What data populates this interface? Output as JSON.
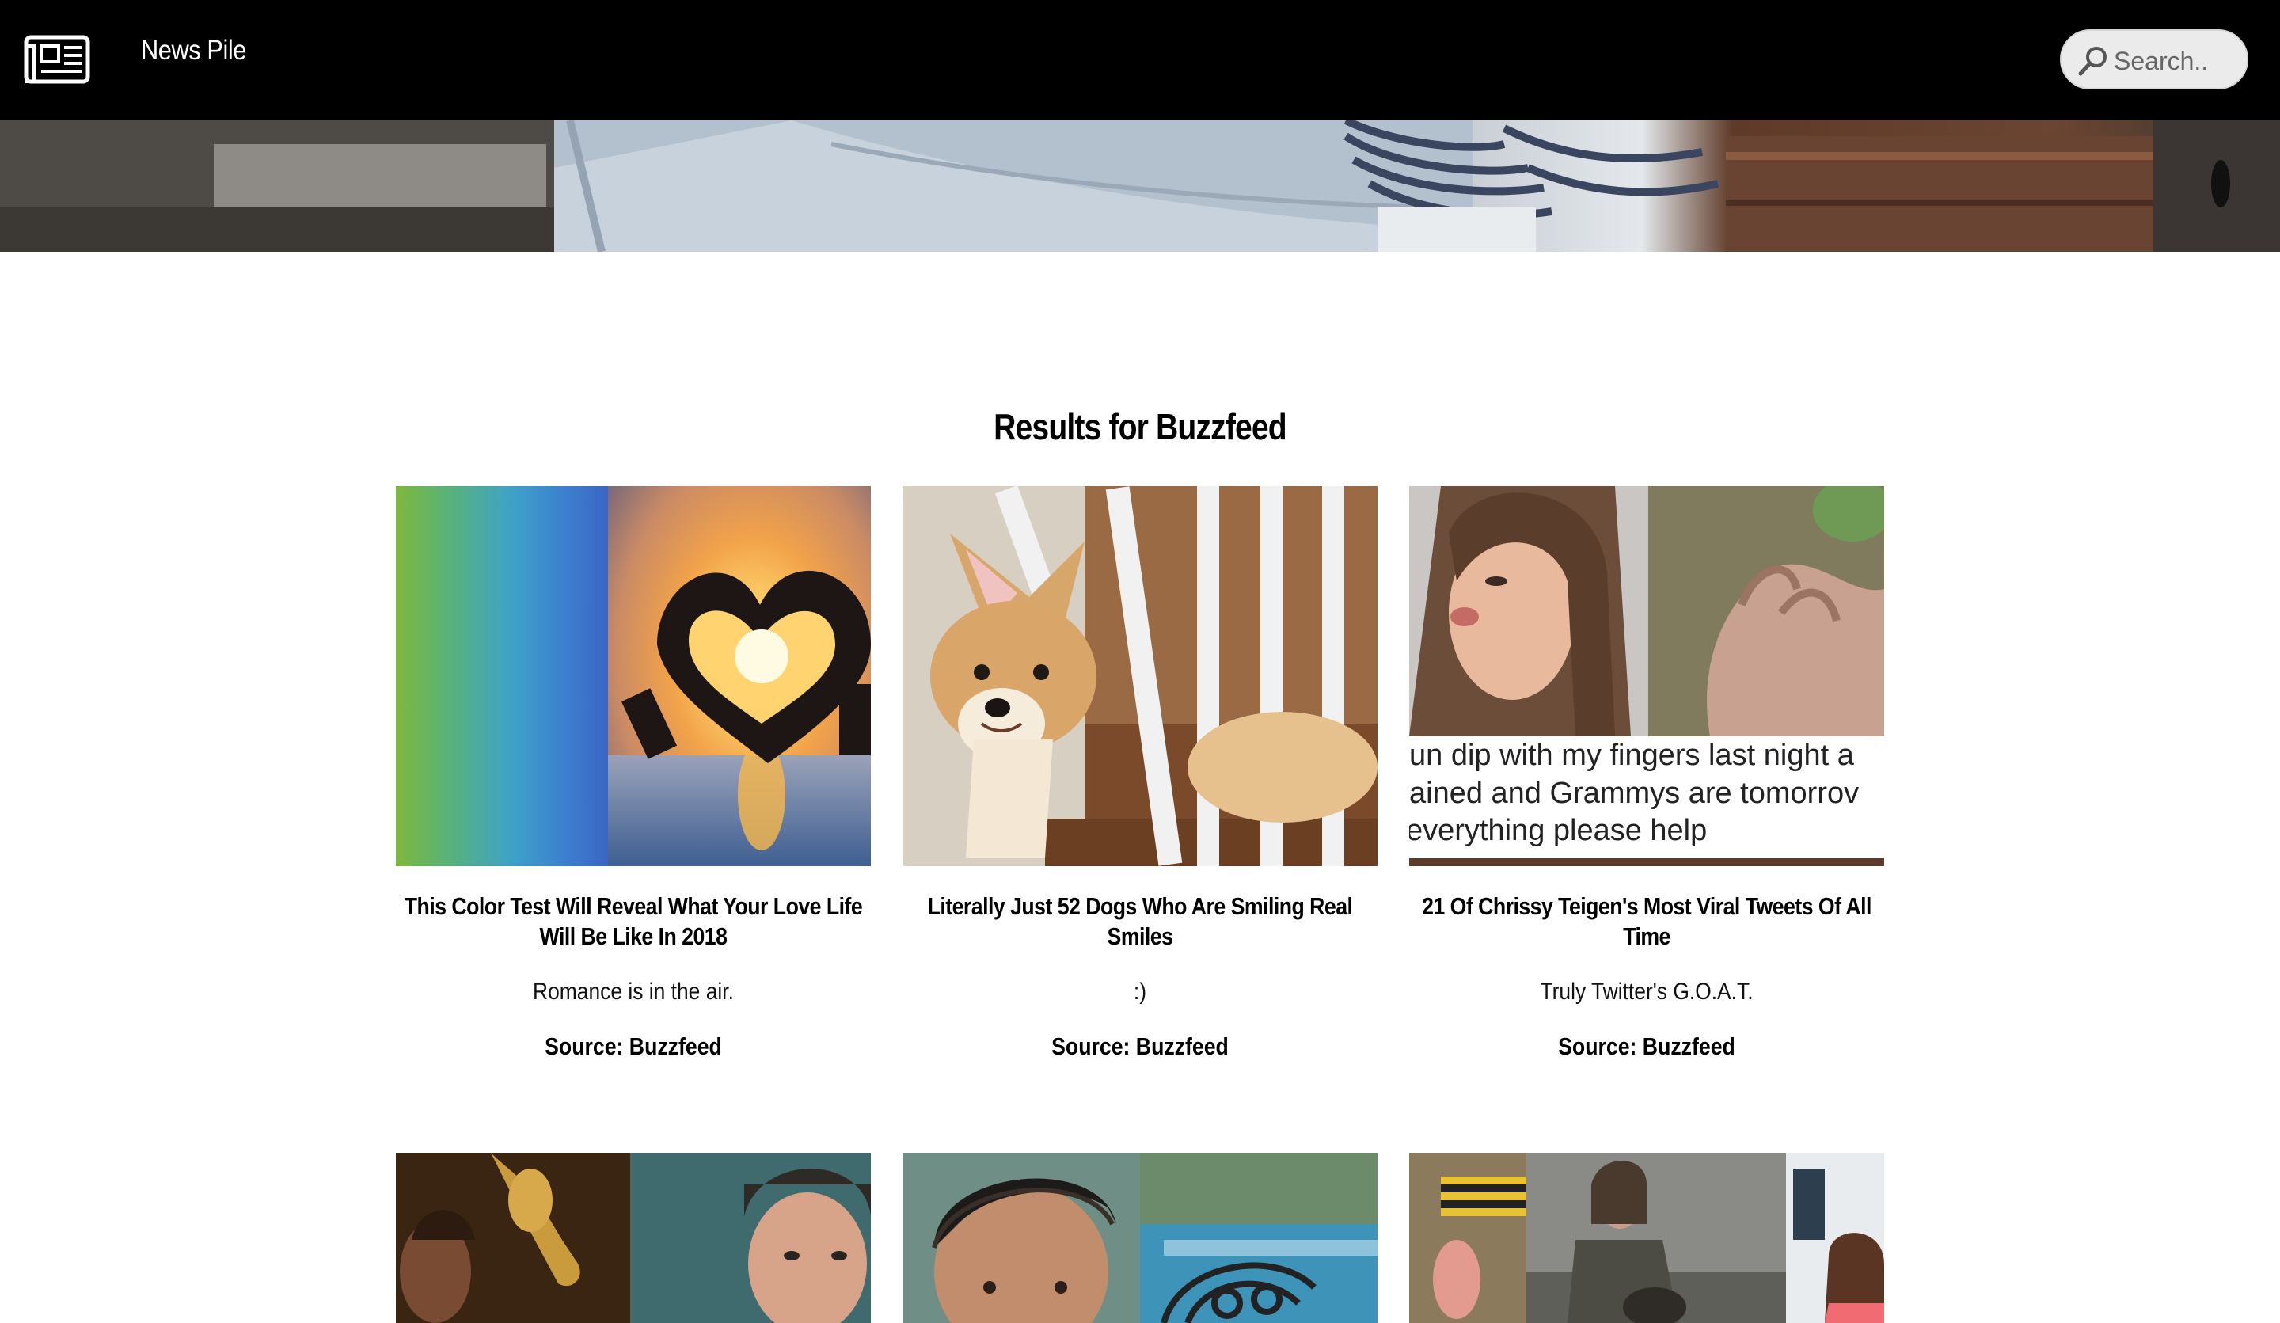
{
  "app": {
    "brand": "News Pile",
    "logo_icon": "newspaper-icon"
  },
  "search": {
    "placeholder": "Search.."
  },
  "results": {
    "heading": "Results for Buzzfeed"
  },
  "articles": [
    {
      "title": "This Color Test Will Reveal What Your Love Life Will Be Like In 2018",
      "description": "Romance is in the air.",
      "source": "Source: Buzzfeed"
    },
    {
      "title": "Literally Just 52 Dogs Who Are Smiling Real Smiles",
      "description": ":)",
      "source": "Source: Buzzfeed"
    },
    {
      "title": "21 Of Chrissy Teigen's Most Viral Tweets Of All Time",
      "description": "Truly Twitter's G.O.A.T.",
      "source": "Source: Buzzfeed",
      "image_caption_lines": [
        "un dip with my fingers last night a",
        "ained and Grammys are tomorrov",
        "everything please help"
      ]
    }
  ]
}
